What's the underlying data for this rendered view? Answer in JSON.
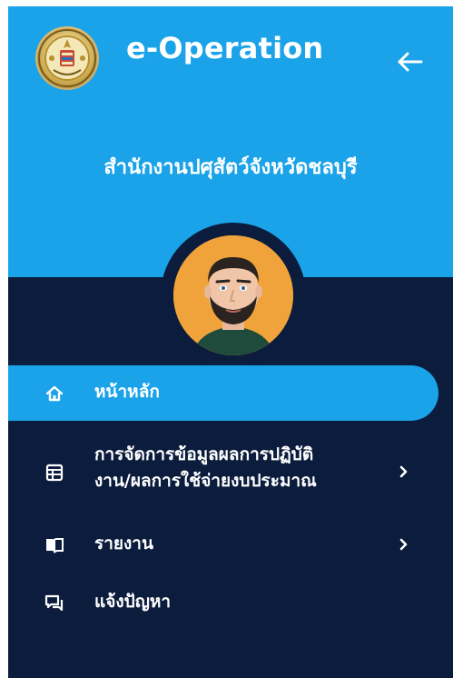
{
  "header": {
    "app_title": "e-Operation",
    "org_name": "สำนักงานปศุสัตว์จังหวัดชลบุรี"
  },
  "menu": {
    "items": [
      {
        "label": "หน้าหลัก",
        "icon": "home-icon",
        "active": true,
        "has_submenu": false
      },
      {
        "label": "การจัดการข้อมูลผลการปฏิบัติ\nงาน/ผลการใช้จ่ายงบประมาณ",
        "icon": "table-icon",
        "active": false,
        "has_submenu": true
      },
      {
        "label": "รายงาน",
        "icon": "book-icon",
        "active": false,
        "has_submenu": true
      },
      {
        "label": "แจ้งปัญหา",
        "icon": "chat-icon",
        "active": false,
        "has_submenu": false
      }
    ]
  },
  "colors": {
    "header_bg": "#1aa3e8",
    "sidebar_bg": "#0b1c3d",
    "active_item_bg": "#1aa3e8",
    "text": "#ffffff"
  }
}
